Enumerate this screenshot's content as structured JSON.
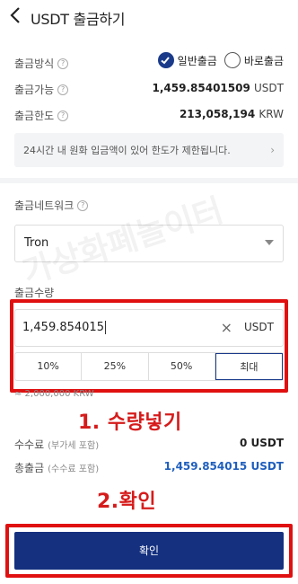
{
  "header": {
    "title": "USDT 출금하기"
  },
  "method": {
    "label": "출금방식",
    "options": [
      "일반출금",
      "바로출금"
    ],
    "selected": "일반출금"
  },
  "available": {
    "label": "출금가능",
    "amount": "1,459.85401509",
    "unit": "USDT"
  },
  "limit": {
    "label": "출금한도",
    "amount": "213,058,194",
    "unit": "KRW"
  },
  "notice": {
    "text": "24시간 내 원화 입금액이 있어 한도가 제한됩니다."
  },
  "network": {
    "label": "출금네트워크",
    "value": "Tron"
  },
  "quantity": {
    "label": "출금수량",
    "value": "1,459.854015",
    "unit": "USDT",
    "percent_buttons": [
      "10%",
      "25%",
      "50%",
      "최대"
    ],
    "active": "최대",
    "krw_estimate": "≈ 2,000,000 KRW"
  },
  "watermark": "가상화폐놀이터",
  "annotations": {
    "step1": "1. 수량넣기",
    "step2": "2.확인"
  },
  "fee": {
    "label": "수수료",
    "sub": "(부가세 포함)",
    "value": "0 USDT"
  },
  "total": {
    "label": "총출금",
    "sub": "(수수료 포함)",
    "value": "1,459.854015 USDT"
  },
  "confirm_label": "확인",
  "colors": {
    "accent": "#14307f",
    "annotation_red": "#e01010",
    "total_blue": "#1f5fbd"
  }
}
